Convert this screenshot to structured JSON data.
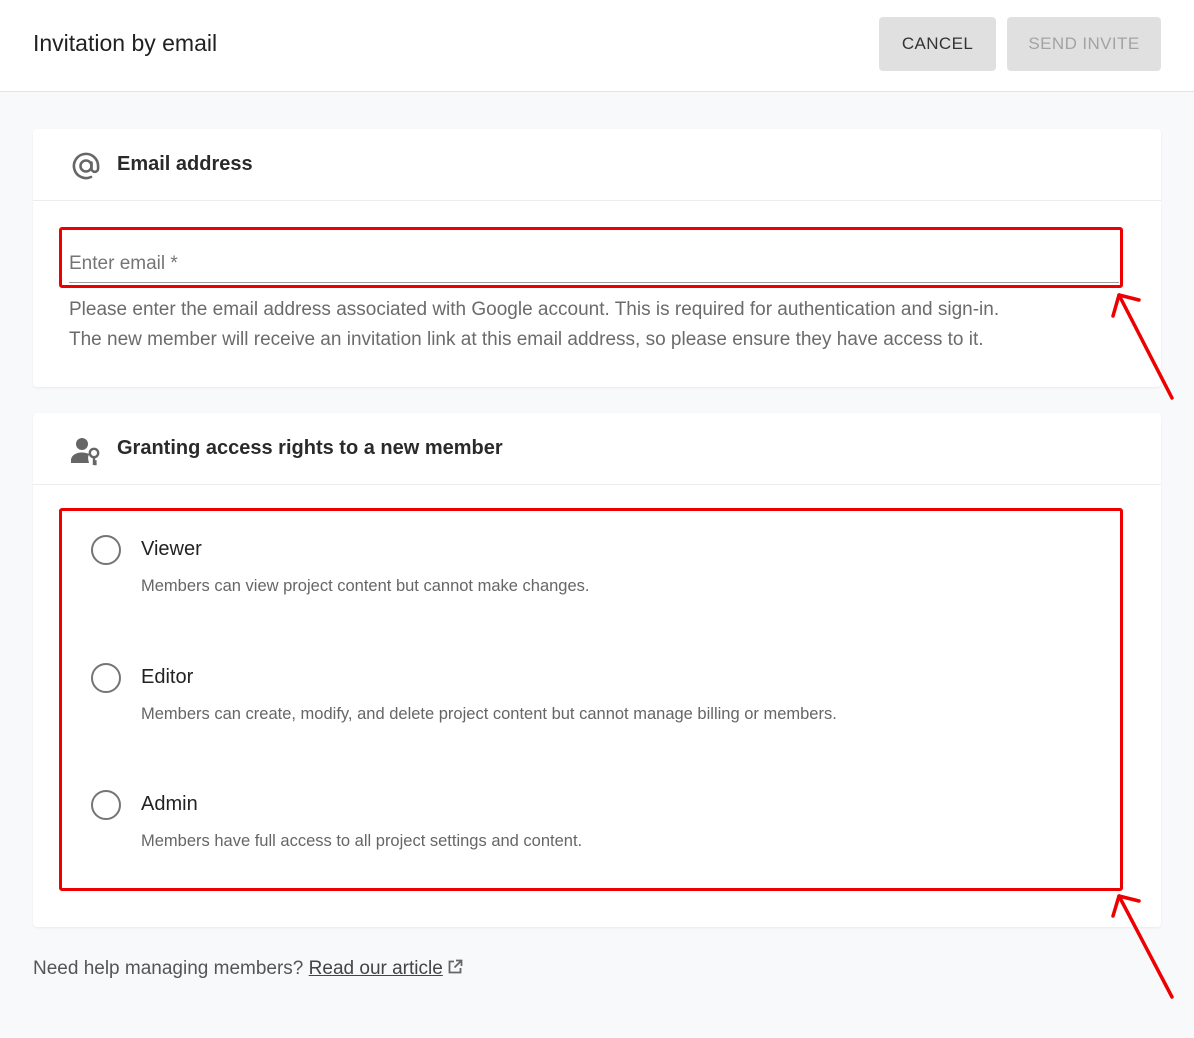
{
  "header": {
    "title": "Invitation by email",
    "cancel_label": "CANCEL",
    "send_label": "SEND INVITE"
  },
  "email_section": {
    "title": "Email address",
    "icon": "at-sign-icon",
    "input_placeholder": "Enter email *",
    "input_value": "",
    "helper_line1": "Please enter the email address associated with Google account. This is required for authentication and sign-in.",
    "helper_line2": "The new member will receive an invitation link at this email address, so please ensure they have access to it."
  },
  "access_section": {
    "title": "Granting access rights to a new member",
    "icon": "person-key-icon",
    "roles": [
      {
        "label": "Viewer",
        "description": "Members can view project content but cannot make changes.",
        "selected": false
      },
      {
        "label": "Editor",
        "description": "Members can create, modify, and delete project content but cannot manage billing or members.",
        "selected": false
      },
      {
        "label": "Admin",
        "description": "Members have full access to all project settings and content.",
        "selected": false
      }
    ]
  },
  "footer": {
    "help_text": "Need help managing members?",
    "link_label": "Read our article",
    "link_icon": "external-link-icon"
  },
  "colors": {
    "annotation": "#ee0000",
    "button_bg": "#e0e0e0",
    "disabled_text": "#a3a3a3"
  }
}
